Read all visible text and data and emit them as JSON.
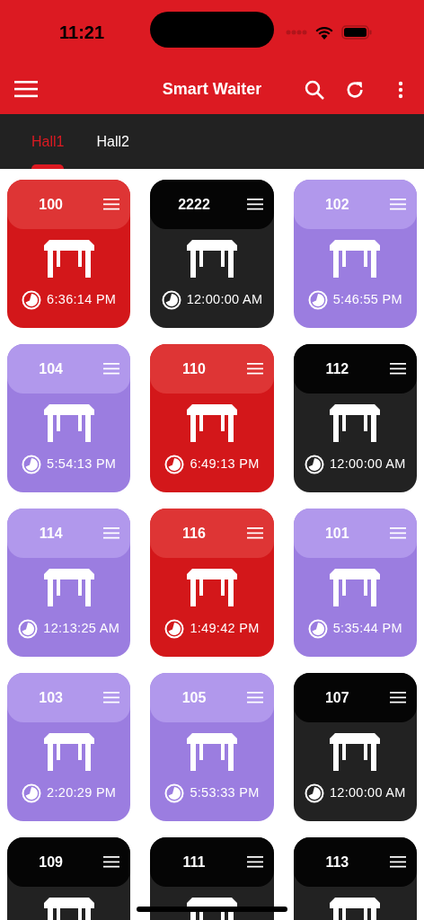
{
  "status_bar": {
    "time": "11:21"
  },
  "app_bar": {
    "title": "Smart Waiter"
  },
  "tabs": [
    {
      "label": "Hall1",
      "selected": true
    },
    {
      "label": "Hall2",
      "selected": false
    }
  ],
  "tables": [
    {
      "number": "100",
      "kind": "busy",
      "time": "6:36:14 PM"
    },
    {
      "number": "2222",
      "kind": "free",
      "time": "12:00:00 AM"
    },
    {
      "number": "102",
      "kind": "reserved",
      "time": "5:46:55 PM"
    },
    {
      "number": "104",
      "kind": "reserved",
      "time": "5:54:13 PM"
    },
    {
      "number": "110",
      "kind": "busy",
      "time": "6:49:13 PM"
    },
    {
      "number": "112",
      "kind": "free",
      "time": "12:00:00 AM"
    },
    {
      "number": "114",
      "kind": "reserved",
      "time": "12:13:25 AM"
    },
    {
      "number": "116",
      "kind": "busy",
      "time": "1:49:42 PM"
    },
    {
      "number": "101",
      "kind": "reserved",
      "time": "5:35:44 PM"
    },
    {
      "number": "103",
      "kind": "reserved",
      "time": "2:20:29 PM"
    },
    {
      "number": "105",
      "kind": "reserved",
      "time": "5:53:33 PM"
    },
    {
      "number": "107",
      "kind": "free",
      "time": "12:00:00 AM"
    },
    {
      "number": "109",
      "kind": "free"
    },
    {
      "number": "111",
      "kind": "free"
    },
    {
      "number": "113",
      "kind": "free"
    }
  ]
}
